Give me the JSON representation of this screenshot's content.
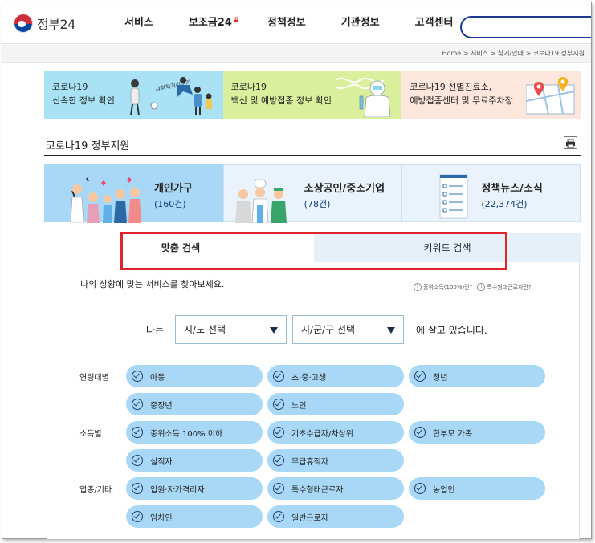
{
  "header": {
    "logo_text": "정부24",
    "menu": [
      {
        "label": "서비스"
      },
      {
        "label": "보조금24",
        "badge": "N"
      },
      {
        "label": "정책정보"
      },
      {
        "label": "기관정보"
      },
      {
        "label": "고객센터"
      }
    ]
  },
  "breadcrumb": "Home > 서비스 > 찾기/안내 > 코로나19 정부지원",
  "banners": [
    {
      "line1": "코로나19",
      "line2": "신속한 정보 확인",
      "art_text": "사회적거리두기"
    },
    {
      "line1": "코로나19",
      "line2": "백신 및 예방접종 정보 확인"
    },
    {
      "line1": "코로나19 선별진료소,",
      "line2": "예방접종센터 및 무료주차장"
    }
  ],
  "section": {
    "title": "코로나19 정부지원"
  },
  "categories": [
    {
      "label": "개인가구",
      "count": "(160건)"
    },
    {
      "label": "소상공인/중소기업",
      "count": "(78건)"
    },
    {
      "label": "정책뉴스/소식",
      "count": "(22,374건)"
    }
  ],
  "tabs": [
    {
      "label": "맞춤 검색"
    },
    {
      "label": "키워드 검색"
    }
  ],
  "guide_text": "나의 상황에 맞는 서비스를 찾아보세요.",
  "help_links": [
    {
      "label": "중위소득(100%)란?"
    },
    {
      "label": "특수형태근로자란?"
    }
  ],
  "region": {
    "prefix": "나는",
    "sido": "시/도 선택",
    "sigungu": "시/군/구 선택",
    "suffix": "에 살고 있습니다."
  },
  "groups": [
    {
      "label": "연령대별",
      "chips": [
        "아동",
        "초·중·고생",
        "청년",
        "중장년",
        "노인"
      ]
    },
    {
      "label": "소득별",
      "chips": [
        "중위소득 100% 이하",
        "기초수급자/차상위",
        "한부모 가족",
        "실직자",
        "무급휴직자"
      ]
    },
    {
      "label": "업종/기타",
      "chips": [
        "입원·자가격리자",
        "특수형태근로자",
        "농업인",
        "임차인",
        "일반근로자"
      ]
    }
  ],
  "colors": {
    "chip_bg": "#a9d8f6",
    "highlight": "#e0242b",
    "search_border": "#1b3a8f"
  }
}
